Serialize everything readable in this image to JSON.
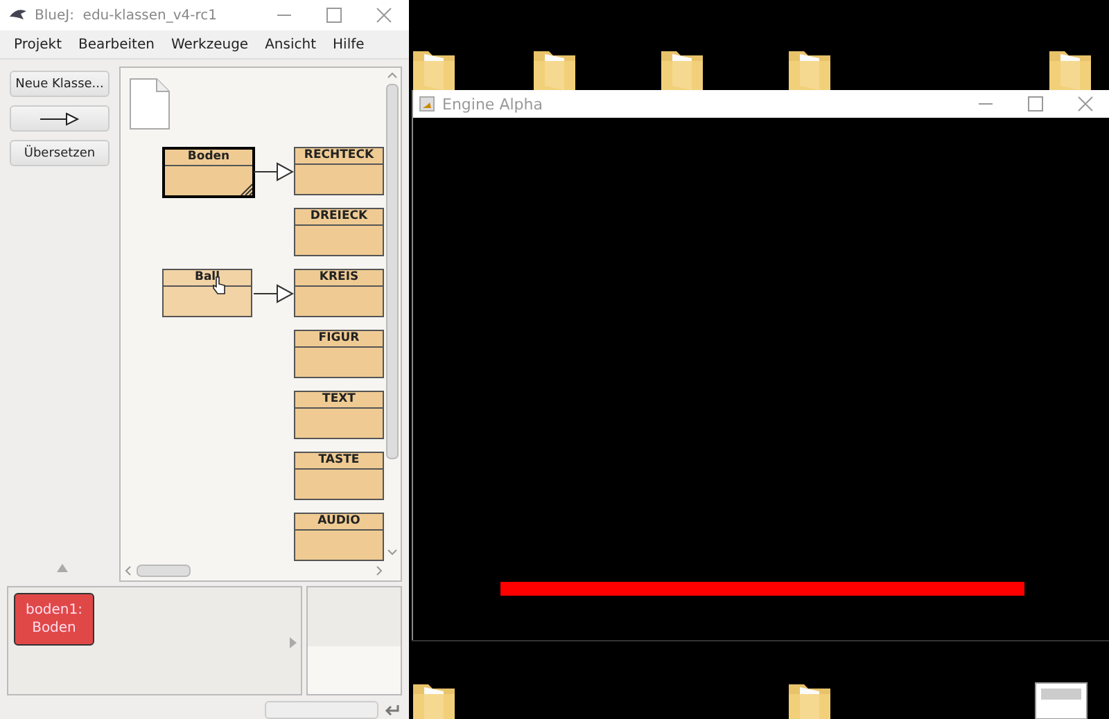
{
  "bluej": {
    "title": "BlueJ:  edu-klassen_v4-rc1",
    "menu": [
      "Projekt",
      "Bearbeiten",
      "Werkzeuge",
      "Ansicht",
      "Hilfe"
    ],
    "buttons": [
      {
        "kind": "text",
        "label": "Neue Klasse..."
      },
      {
        "kind": "arrow"
      },
      {
        "kind": "text",
        "label": "Übersetzen"
      }
    ],
    "diagram_rows": [
      {
        "subclass": {
          "name": "Boden",
          "selected": true
        },
        "class": {
          "name": "RECHTECK",
          "selected": false
        }
      },
      {
        "class": {
          "name": "DREIECK",
          "selected": false
        }
      },
      {
        "subclass": {
          "name": "Ball",
          "selected": false
        },
        "class": {
          "name": "KREIS",
          "selected": false
        }
      },
      {
        "class": {
          "name": "FIGUR",
          "selected": false
        }
      },
      {
        "class": {
          "name": "TEXT",
          "selected": false
        }
      },
      {
        "class": {
          "name": "TASTE",
          "selected": false
        }
      },
      {
        "class": {
          "name": "AUDIO",
          "selected": false
        }
      }
    ],
    "objects": [
      {
        "name": "boden1:",
        "type": "Boden"
      }
    ]
  },
  "engine_window": {
    "title": "Engine Alpha"
  }
}
